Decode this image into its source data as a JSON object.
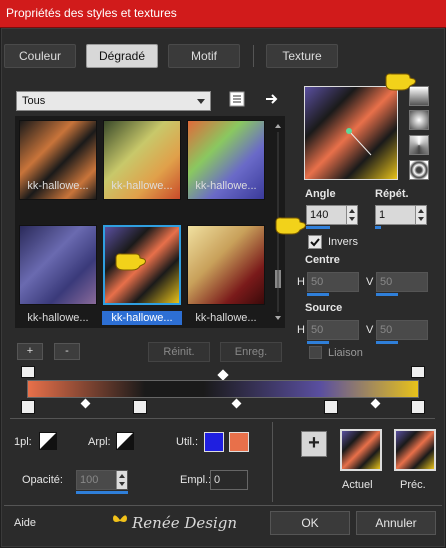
{
  "window": {
    "title": "Propriétés des styles et textures"
  },
  "tabs": [
    {
      "label": "Couleur",
      "active": false
    },
    {
      "label": "Dégradé",
      "active": true
    },
    {
      "label": "Motif",
      "active": false
    },
    {
      "label": "Texture",
      "active": false
    }
  ],
  "library": {
    "category": "Tous",
    "thumbnails": [
      {
        "label": "kk-hallowe...",
        "selected": false
      },
      {
        "label": "kk-hallowe...",
        "selected": false
      },
      {
        "label": "kk-hallowe...",
        "selected": false
      },
      {
        "label": "kk-hallowe...",
        "selected": false
      },
      {
        "label": "kk-hallowe...",
        "selected": true
      },
      {
        "label": "kk-hallowe...",
        "selected": false
      }
    ],
    "add_label": "+",
    "remove_label": "-",
    "reset_label": "Réinit.",
    "save_label": "Enreg."
  },
  "gradient_settings": {
    "angle_label": "Angle",
    "angle_value": "140",
    "repeat_label": "Répét.",
    "repeat_value": "1",
    "invert_label": "Invers",
    "invert_checked": true,
    "center_label": "Centre",
    "center_h_label": "H",
    "center_h_value": "50",
    "center_v_label": "V",
    "center_v_value": "50",
    "source_label": "Source",
    "source_h_label": "H",
    "source_h_value": "50",
    "source_v_label": "V",
    "source_v_value": "50",
    "link_label": "Liaison"
  },
  "stops": {
    "pl_label": "1pl:",
    "arpl_label": "Arpl:",
    "util_label": "Util.:",
    "util_color_1": "#1f1fe0",
    "util_color_2": "#e8704a",
    "opacity_label": "Opacité:",
    "opacity_value": "100",
    "empl_label": "Empl.:",
    "empl_value": "0"
  },
  "preview": {
    "add_label": "+",
    "current_label": "Actuel",
    "previous_label": "Préc."
  },
  "footer": {
    "help_label": "Aide",
    "watermark": "Renée Design",
    "ok_label": "OK",
    "cancel_label": "Annuler"
  },
  "colors": {
    "titlebar": "#d11b1b",
    "accent": "#2f7fd9",
    "gradient_orange": "#e8704a",
    "gradient_purple": "#5a4fa0",
    "gradient_yellow": "#e8c21a"
  }
}
